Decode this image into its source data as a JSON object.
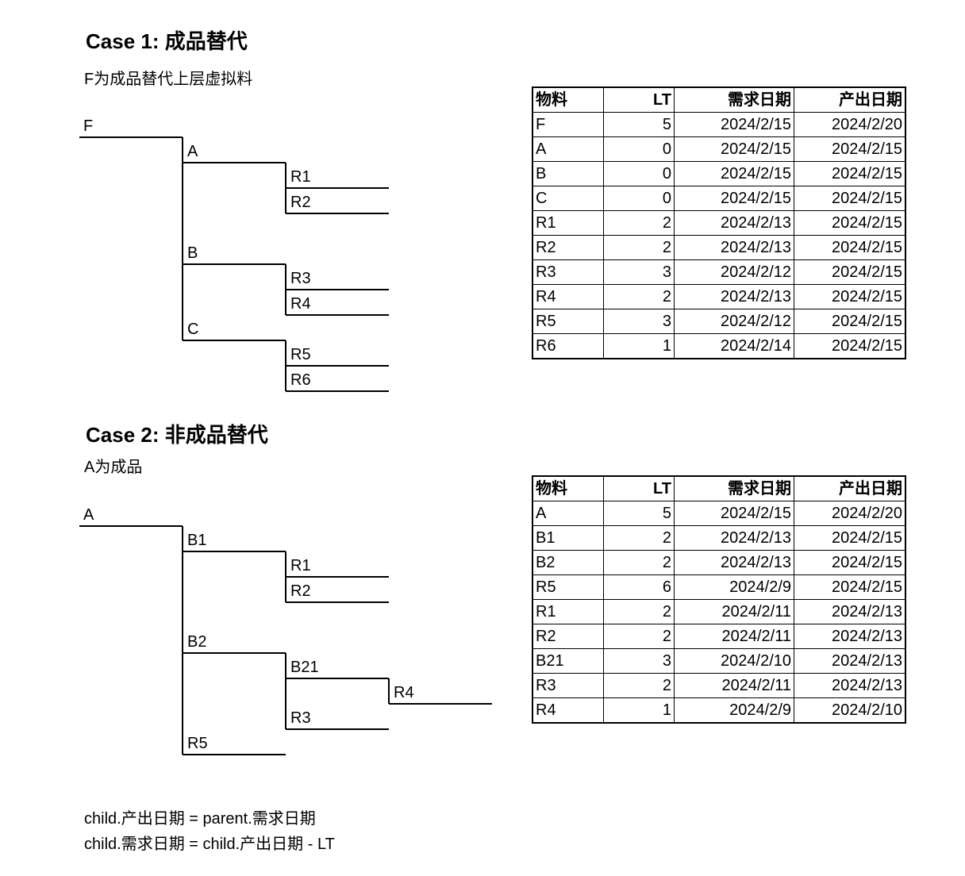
{
  "case1": {
    "title": "Case 1: 成品替代",
    "subtitle": "F为成品替代上层虚拟料",
    "tree": {
      "F": "F",
      "A": "A",
      "R1": "R1",
      "R2": "R2",
      "B": "B",
      "R3": "R3",
      "R4": "R4",
      "C": "C",
      "R5": "R5",
      "R6": "R6"
    },
    "table": {
      "headers": [
        "物料",
        "LT",
        "需求日期",
        "产出日期"
      ],
      "rows": [
        [
          "F",
          "5",
          "2024/2/15",
          "2024/2/20"
        ],
        [
          "A",
          "0",
          "2024/2/15",
          "2024/2/15"
        ],
        [
          "B",
          "0",
          "2024/2/15",
          "2024/2/15"
        ],
        [
          "C",
          "0",
          "2024/2/15",
          "2024/2/15"
        ],
        [
          "R1",
          "2",
          "2024/2/13",
          "2024/2/15"
        ],
        [
          "R2",
          "2",
          "2024/2/13",
          "2024/2/15"
        ],
        [
          "R3",
          "3",
          "2024/2/12",
          "2024/2/15"
        ],
        [
          "R4",
          "2",
          "2024/2/13",
          "2024/2/15"
        ],
        [
          "R5",
          "3",
          "2024/2/12",
          "2024/2/15"
        ],
        [
          "R6",
          "1",
          "2024/2/14",
          "2024/2/15"
        ]
      ]
    }
  },
  "case2": {
    "title": "Case 2: 非成品替代",
    "subtitle": "A为成品",
    "tree": {
      "A": "A",
      "B1": "B1",
      "R1": "R1",
      "R2": "R2",
      "B2": "B2",
      "B21": "B21",
      "R4": "R4",
      "R3": "R3",
      "R5": "R5"
    },
    "table": {
      "headers": [
        "物料",
        "LT",
        "需求日期",
        "产出日期"
      ],
      "rows": [
        [
          "A",
          "5",
          "2024/2/15",
          "2024/2/20"
        ],
        [
          "B1",
          "2",
          "2024/2/13",
          "2024/2/15"
        ],
        [
          "B2",
          "2",
          "2024/2/13",
          "2024/2/15"
        ],
        [
          "R5",
          "6",
          "2024/2/9",
          "2024/2/15"
        ],
        [
          "R1",
          "2",
          "2024/2/11",
          "2024/2/13"
        ],
        [
          "R2",
          "2",
          "2024/2/11",
          "2024/2/13"
        ],
        [
          "B21",
          "3",
          "2024/2/10",
          "2024/2/13"
        ],
        [
          "R3",
          "2",
          "2024/2/11",
          "2024/2/13"
        ],
        [
          "R4",
          "1",
          "2024/2/9",
          "2024/2/10"
        ]
      ]
    }
  },
  "formulas": [
    "child.产出日期 = parent.需求日期",
    "child.需求日期 = child.产出日期 - LT"
  ]
}
